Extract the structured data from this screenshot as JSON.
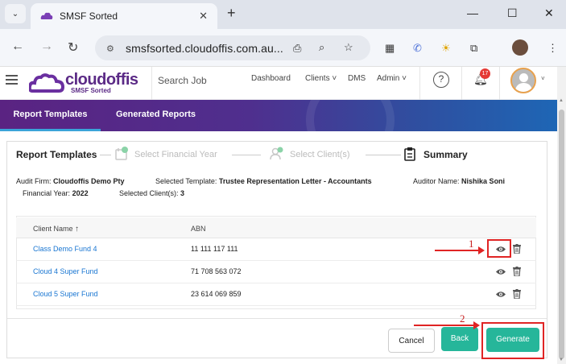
{
  "browser": {
    "tab_title": "SMSF Sorted",
    "url": "smsfsorted.cloudoffis.com.au...",
    "new_tab": "+",
    "tab_close": "✕"
  },
  "header": {
    "logo_text": "cloudoffis",
    "logo_sub": "SMSF Sorted",
    "search_placeholder": "Search Job",
    "menu": [
      "Dashboard",
      "Clients",
      "DMS",
      "Admin"
    ],
    "notification_count": "17"
  },
  "tabs": [
    "Report Templates",
    "Generated Reports"
  ],
  "stepper": {
    "title": "Report Templates",
    "steps": [
      "Select Financial Year",
      "Select Client(s)",
      "Summary"
    ]
  },
  "info": {
    "audit_firm_label": "Audit Firm:",
    "audit_firm": "Cloudoffis Demo Pty",
    "template_label": "Selected Template:",
    "template": "Trustee Representation Letter - Accountants",
    "auditor_label": "Auditor Name:",
    "auditor": "Nishika Soni",
    "fy_label": "Financial Year:",
    "fy": "2022",
    "clients_label": "Selected Client(s):",
    "clients": "3"
  },
  "table": {
    "columns": [
      "Client Name",
      "ABN"
    ],
    "sort_icon": "↑",
    "rows": [
      {
        "name": "Class Demo Fund 4",
        "abn": "11 111 117 111"
      },
      {
        "name": "Cloud 4 Super Fund",
        "abn": "71 708 563 072"
      },
      {
        "name": "Cloud 5 Super Fund",
        "abn": "23 614 069 859"
      }
    ]
  },
  "buttons": {
    "cancel": "Cancel",
    "back": "Back",
    "generate": "Generate"
  },
  "annotations": [
    "1",
    "2"
  ],
  "colors": {
    "brand_purple": "#5b2a86",
    "teal": "#26b69a",
    "annotation_red": "#e02424",
    "link_blue": "#1976d2"
  }
}
